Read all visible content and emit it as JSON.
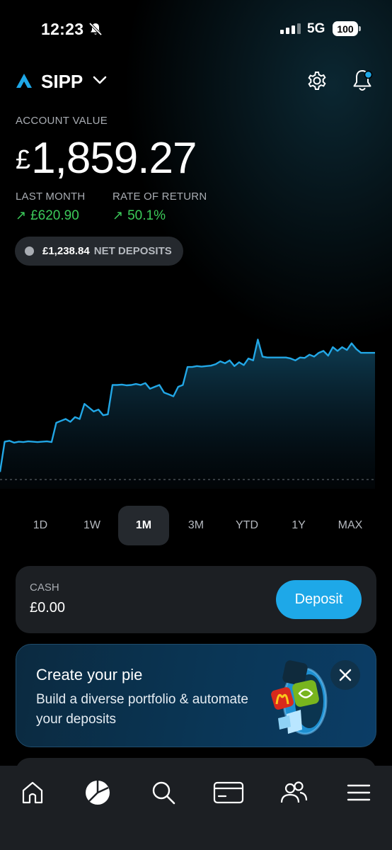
{
  "status_bar": {
    "time": "12:23",
    "network": "5G",
    "battery": "100"
  },
  "header": {
    "account_name": "SIPP"
  },
  "summary": {
    "account_value_label": "ACCOUNT VALUE",
    "currency_symbol": "£",
    "account_value": "1,859.27",
    "last_month_label": "LAST MONTH",
    "last_month_value": "£620.90",
    "rate_of_return_label": "RATE OF RETURN",
    "rate_of_return_value": "50.1%",
    "net_deposits_amount": "£1,238.84",
    "net_deposits_label": "NET DEPOSITS"
  },
  "colors": {
    "accent": "#1ea8e8",
    "positive": "#3ccb5a",
    "line": "#22a7e6"
  },
  "chart_data": {
    "type": "line",
    "title": "",
    "xlabel": "",
    "ylabel": "",
    "grid": false,
    "baseline_dashed": true,
    "x": [
      0,
      1,
      2,
      3,
      4,
      5,
      6,
      7,
      8,
      9,
      10,
      11,
      12,
      13,
      14,
      15,
      16,
      17,
      18,
      19,
      20,
      21,
      22,
      23,
      24,
      25,
      26,
      27,
      28,
      29,
      30,
      31,
      32,
      33,
      34,
      35,
      36,
      37,
      38,
      39,
      40,
      41,
      42,
      43,
      44,
      45,
      46,
      47,
      48,
      49,
      50,
      51,
      52,
      53,
      54,
      55,
      56,
      57,
      58,
      59,
      60,
      61,
      62,
      63,
      64,
      65,
      66,
      67,
      68,
      69,
      70,
      71,
      72,
      73,
      74,
      75,
      76,
      77,
      78,
      79,
      80
    ],
    "values": [
      1240,
      1400,
      1405,
      1395,
      1400,
      1398,
      1402,
      1400,
      1398,
      1400,
      1402,
      1398,
      1500,
      1510,
      1520,
      1505,
      1530,
      1520,
      1600,
      1580,
      1560,
      1570,
      1540,
      1545,
      1700,
      1700,
      1702,
      1698,
      1700,
      1705,
      1700,
      1710,
      1680,
      1690,
      1700,
      1660,
      1650,
      1640,
      1690,
      1700,
      1795,
      1795,
      1800,
      1797,
      1800,
      1802,
      1810,
      1825,
      1815,
      1830,
      1800,
      1820,
      1805,
      1840,
      1830,
      1940,
      1850,
      1845,
      1845,
      1845,
      1845,
      1845,
      1840,
      1830,
      1845,
      1843,
      1860,
      1850,
      1870,
      1880,
      1855,
      1900,
      1880,
      1900,
      1885,
      1920,
      1890,
      1870,
      1870,
      1870,
      1870
    ],
    "ylim": [
      1200,
      2050
    ]
  },
  "time_ranges": {
    "options": [
      "1D",
      "1W",
      "1M",
      "3M",
      "YTD",
      "1Y",
      "MAX"
    ],
    "selected": "1M"
  },
  "cash": {
    "label": "CASH",
    "value": "£0.00",
    "deposit_label": "Deposit"
  },
  "promo": {
    "title": "Create your pie",
    "description": "Build a diverse portfolio & automate your deposits"
  },
  "tab_bar": {
    "items": [
      "home-icon",
      "pie-chart-icon",
      "search-icon",
      "card-icon",
      "people-icon",
      "menu-icon"
    ],
    "selected": "pie-chart-icon"
  }
}
